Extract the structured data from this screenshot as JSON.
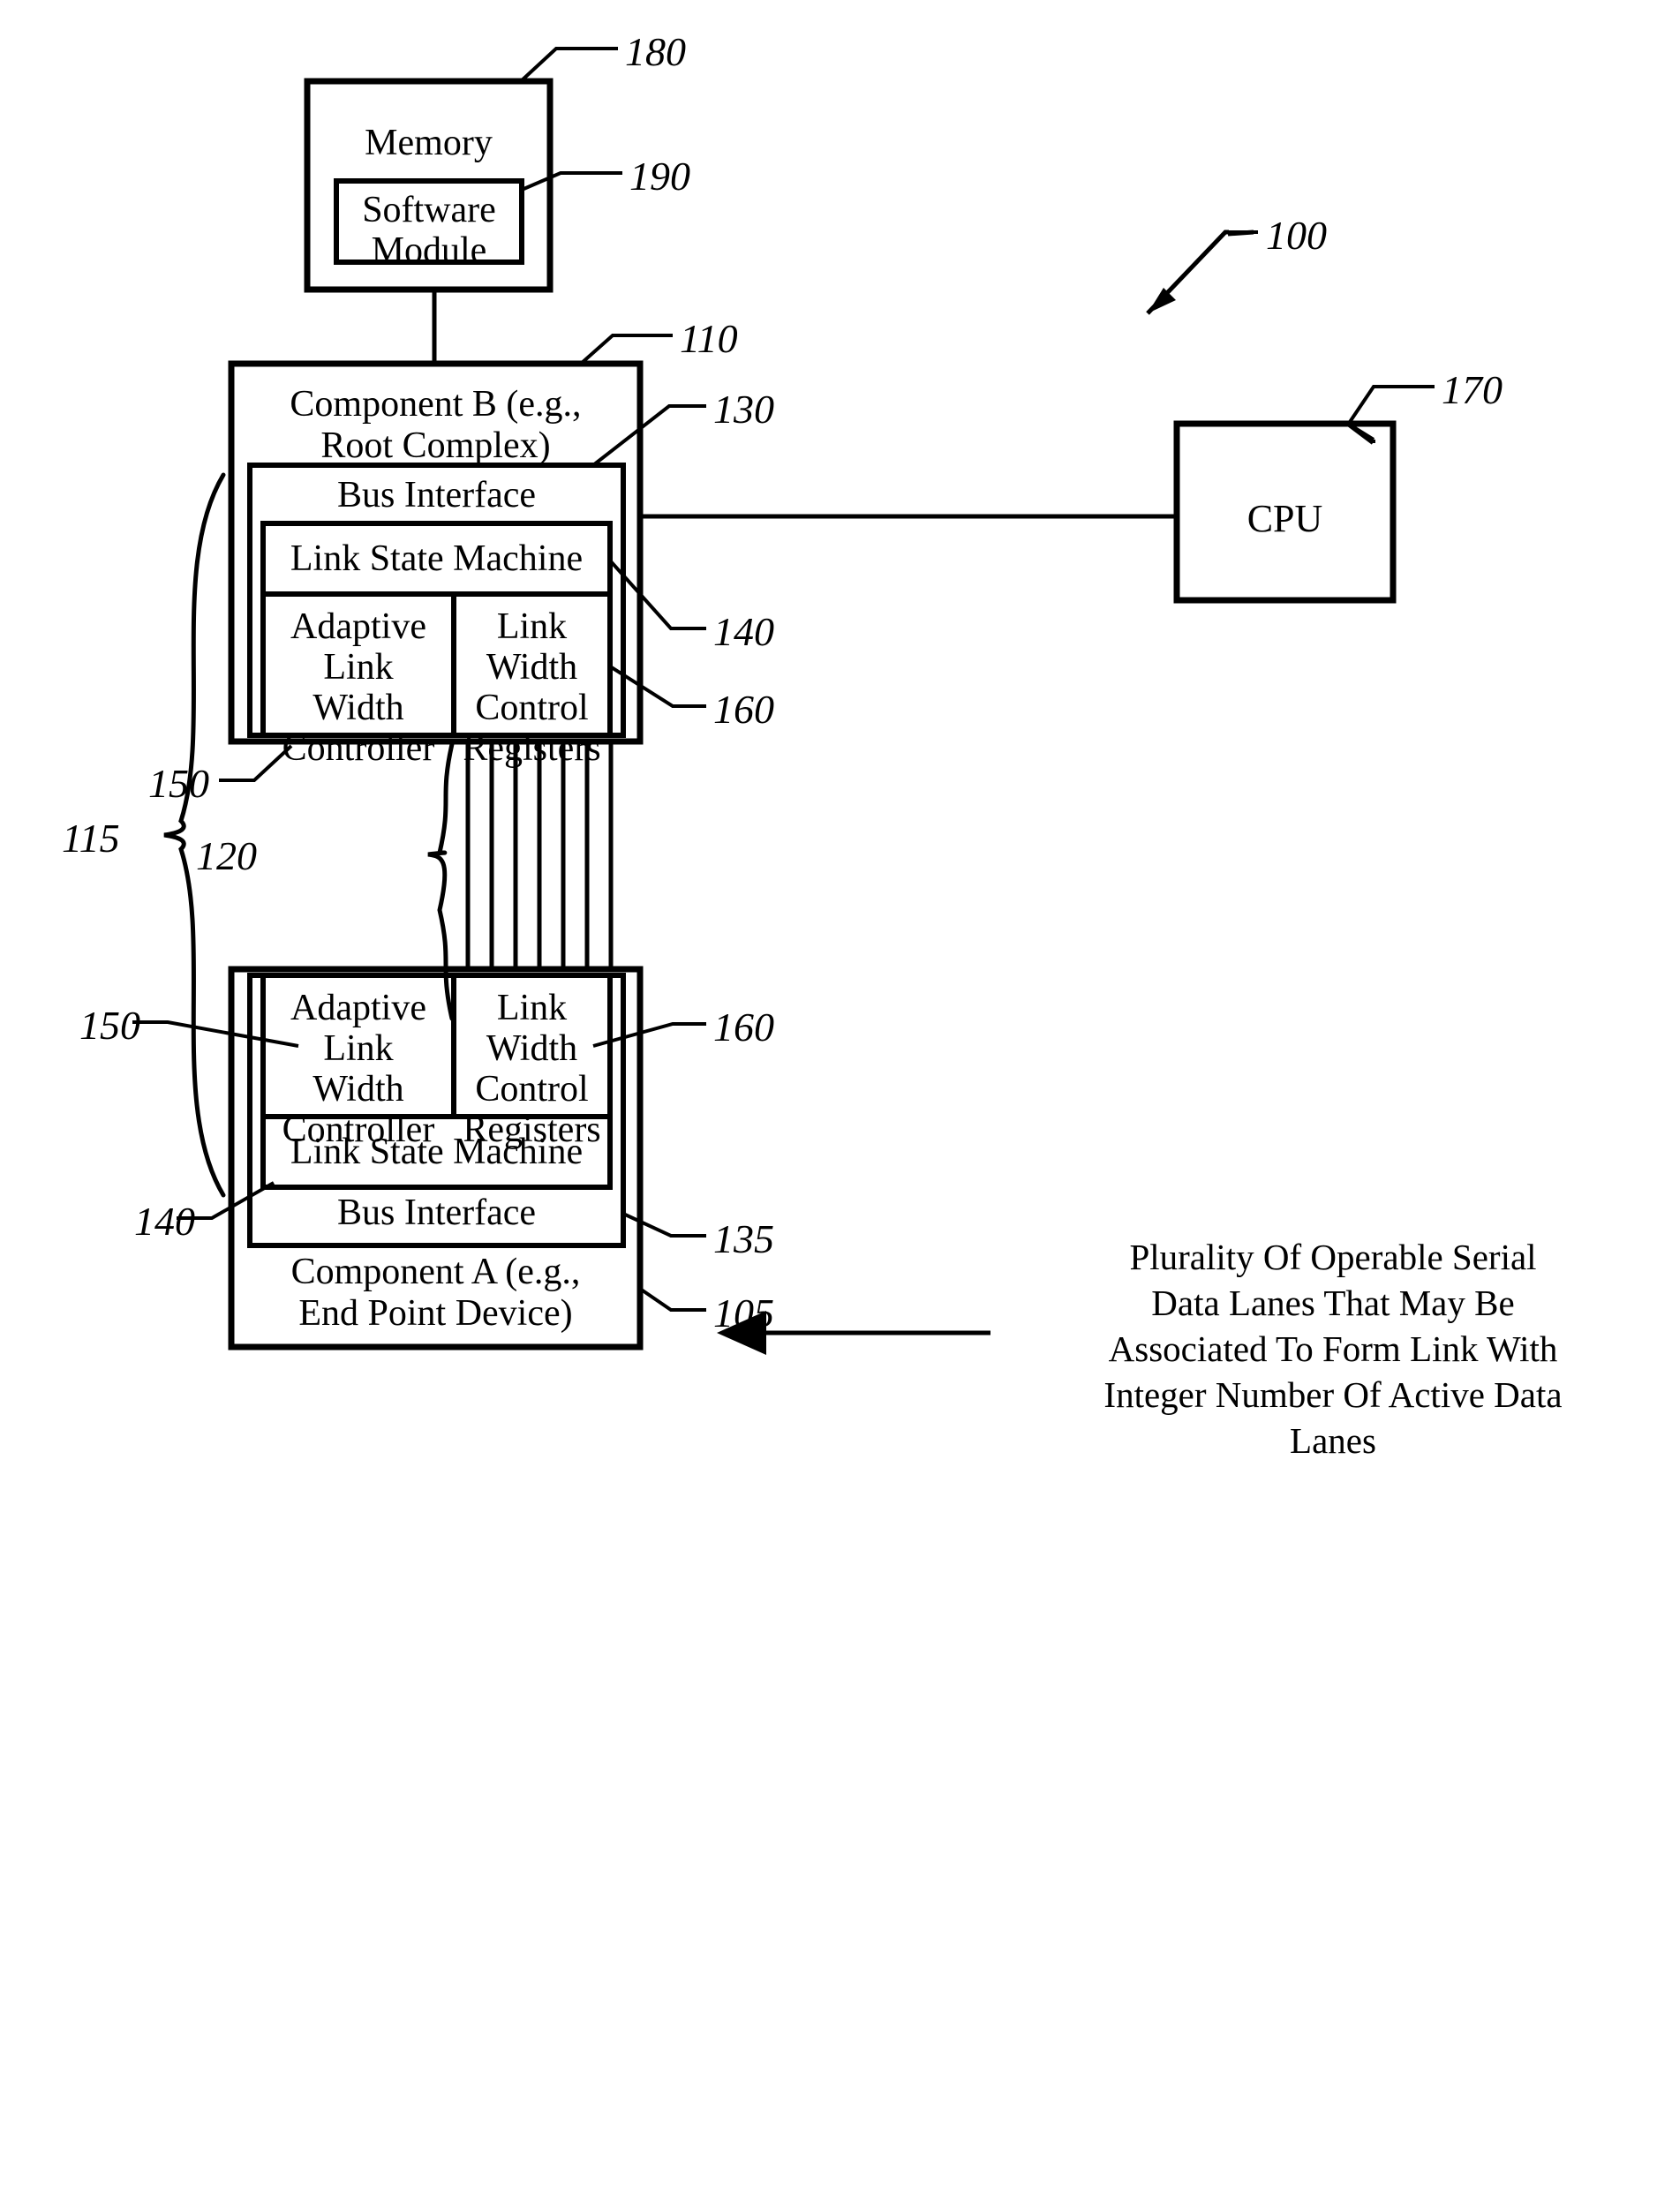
{
  "figure": {
    "title_ref": "100",
    "boxes": {
      "memory": {
        "label": "Memory",
        "ref": "180"
      },
      "software_module": {
        "line1": "Software",
        "line2": "Module",
        "ref": "190"
      },
      "component_b": {
        "line1": "Component B (e.g.,",
        "line2": "Root Complex)",
        "ref": "110"
      },
      "bus_interface_b": {
        "label": "Bus Interface",
        "ref": "130"
      },
      "link_state_machine_b": {
        "label": "Link State Machine",
        "ref": "140"
      },
      "adaptive_link_width_controller_b": {
        "line1": "Adaptive Link",
        "line2": "Width",
        "line3": "Controller",
        "ref": "150"
      },
      "link_width_control_registers_b": {
        "line1": "Link Width",
        "line2": "Control",
        "line3": "Registers",
        "ref": "160"
      },
      "cpu": {
        "label": "CPU",
        "ref": "170"
      },
      "component_a": {
        "line1": "Component A (e.g.,",
        "line2": "End Point Device)",
        "ref": "105"
      },
      "bus_interface_a": {
        "label": "Bus Interface",
        "ref": "135"
      },
      "link_state_machine_a": {
        "label": "Link State Machine",
        "ref": "140"
      },
      "adaptive_link_width_controller_a": {
        "line1": "Adaptive Link",
        "line2": "Width",
        "line3": "Controller",
        "ref": "150"
      },
      "link_width_control_registers_a": {
        "line1": "Link Width",
        "line2": "Control",
        "line3": "Registers",
        "ref": "160"
      }
    },
    "braces": {
      "link_brace": {
        "ref": "115"
      },
      "lanes_brace": {
        "ref": "120"
      }
    },
    "annotation": {
      "line1": "Plurality Of Operable Serial",
      "line2": "Data Lanes That May Be",
      "line3": "Associated To Form Link With",
      "line4": "Integer Number Of Active Data",
      "line5": "Lanes"
    },
    "lane_count": 7,
    "colors": {
      "ink": "#000000",
      "paper": "#ffffff"
    }
  }
}
